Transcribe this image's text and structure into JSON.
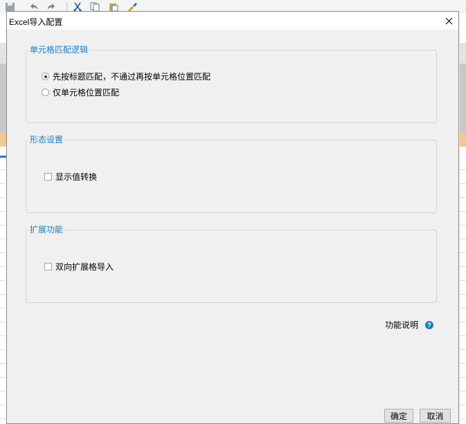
{
  "dialog": {
    "title": "Excel导入配置",
    "close_icon": "close-icon"
  },
  "groups": {
    "match_logic": {
      "title": "单元格匹配逻辑",
      "options": [
        {
          "label": "先按标题匹配，不通过再按单元格位置匹配",
          "selected": true
        },
        {
          "label": "仅单元格位置匹配",
          "selected": false
        }
      ]
    },
    "form_settings": {
      "title": "形态设置",
      "checkbox_label": "显示值转换",
      "checked": false
    },
    "extension": {
      "title": "扩展功能",
      "checkbox_label": "双向扩展格导入",
      "checked": false
    }
  },
  "help": {
    "label": "功能说明",
    "icon": "help-icon",
    "glyph": "?"
  },
  "buttons": {
    "ok": "确定",
    "cancel": "取消"
  },
  "colors": {
    "group_title": "#1a7fc4",
    "help_icon": "#1a7fc4"
  }
}
